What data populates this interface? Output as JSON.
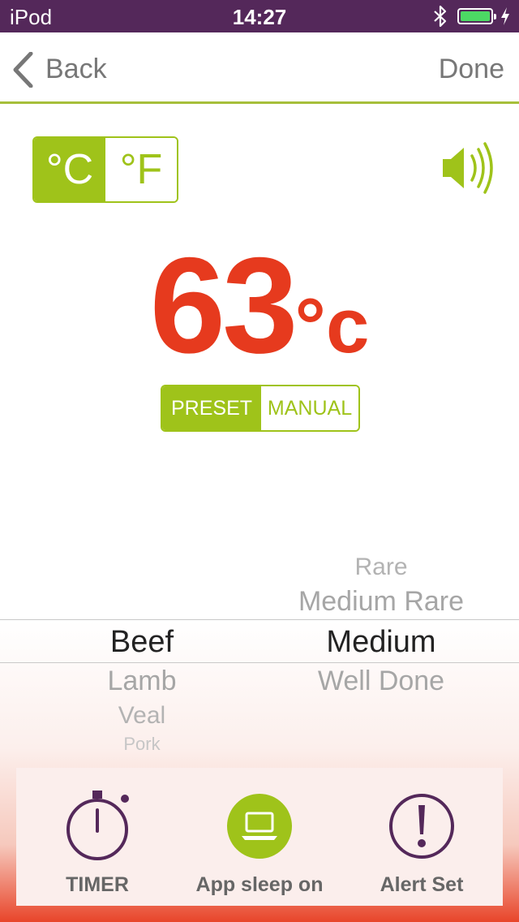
{
  "status_bar": {
    "carrier": "iPod",
    "time": "14:27"
  },
  "nav": {
    "back_label": "Back",
    "done_label": "Done"
  },
  "unit_toggle": {
    "celsius": "°C",
    "fahrenheit": "°F",
    "selected": "celsius"
  },
  "temperature": {
    "value": "63",
    "unit": "°c",
    "color": "#e63a1e"
  },
  "mode_toggle": {
    "preset": "PRESET",
    "manual": "MANUAL",
    "selected": "preset"
  },
  "picker": {
    "meat": {
      "selected": "Beef",
      "below": [
        "Lamb",
        "Veal",
        "Pork"
      ]
    },
    "doneness": {
      "above": [
        "Rare",
        "Medium Rare"
      ],
      "selected": "Medium",
      "below": [
        "Well Done"
      ]
    }
  },
  "tabs": {
    "timer": "TIMER",
    "sleep": "App sleep on",
    "alert": "Alert Set"
  },
  "icons": {
    "back": "chevron-left-icon",
    "speaker": "speaker-icon",
    "timer": "stopwatch-icon",
    "sleep": "laptop-icon",
    "alert": "exclamation-icon"
  },
  "colors": {
    "accent": "#9fc31a",
    "status_bar": "#54285a",
    "temperature": "#e63a1e",
    "icon_purple": "#54285a"
  }
}
